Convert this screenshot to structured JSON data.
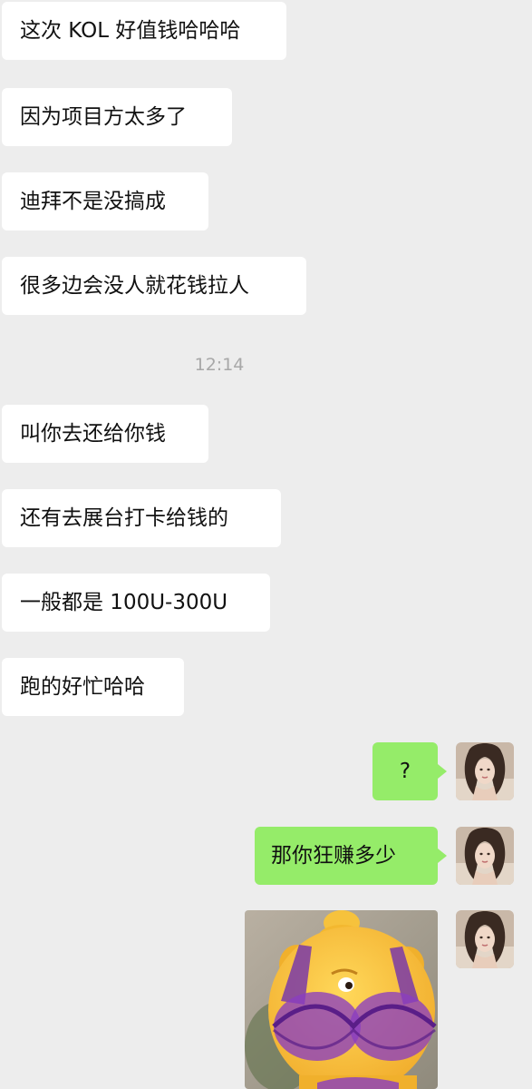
{
  "incoming_messages": [
    "这次 KOL 好值钱哈哈哈",
    "因为项目方太多了",
    "迪拜不是没搞成",
    "很多边会没人就花钱拉人",
    "叫你去还给你钱",
    "还有去展台打卡给钱的",
    "一般都是 100U-300U",
    "跑的好忙哈哈"
  ],
  "timestamp": "12:14",
  "outgoing_messages": [
    "?",
    "那你狂赚多少"
  ],
  "avatar_icon": "user-avatar-photo",
  "sticker_icon": "cartoon-bear-sticker",
  "colors": {
    "background": "#ededed",
    "incoming_bubble": "#ffffff",
    "outgoing_bubble": "#95ec69",
    "timestamp_text": "#a8a8a8"
  }
}
